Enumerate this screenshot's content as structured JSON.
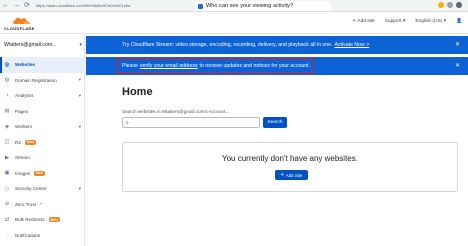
{
  "browser": {
    "back": "←",
    "forward": "→",
    "reload": "⟳",
    "url": "https://dash.cloudflare.com/9b548d6e5f7a02d401cba",
    "tab_title": "Who can see your viewing activity?"
  },
  "header": {
    "brand": "CLOUDFLARE",
    "add_site": "Add site",
    "support": "Support",
    "language": "English (US)",
    "accent": "#f6821f"
  },
  "sidebar": {
    "account": "Wtatters@gmail.com...",
    "items": [
      {
        "label": "Websites",
        "icon": "globe-icon",
        "glyph": "◎",
        "active": true
      },
      {
        "label": "Domain Registration",
        "icon": "globe-icon",
        "glyph": "◍",
        "caret": "▾"
      },
      {
        "label": "Analytics",
        "icon": "chart-icon",
        "glyph": "◔",
        "caret": "▾"
      },
      {
        "label": "Pages",
        "icon": "pages-icon",
        "glyph": "▤"
      },
      {
        "label": "Workers",
        "icon": "workers-icon",
        "glyph": "◈",
        "caret": "▾"
      },
      {
        "label": "R2",
        "icon": "storage-icon",
        "glyph": "◫",
        "badge": "New"
      },
      {
        "label": "Stream",
        "icon": "stream-icon",
        "glyph": "▶"
      },
      {
        "label": "Images",
        "icon": "image-icon",
        "glyph": "▣",
        "badge": "New"
      },
      {
        "label": "Security Center",
        "icon": "shield-icon",
        "glyph": "◇",
        "caret": "▾"
      },
      {
        "label": "Zero Trust",
        "icon": "lock-icon",
        "glyph": "⊖",
        "extra": "↗"
      },
      {
        "label": "Bulk Redirects",
        "icon": "redirect-icon",
        "glyph": "⇄",
        "badge": "Beta"
      },
      {
        "label": "Notifications",
        "icon": "bell-icon",
        "glyph": "◌"
      }
    ]
  },
  "banners": {
    "stream_text": "Try Cloudflare Stream: video storage, encoding, recording, delivery, and playback all in one.",
    "stream_link": "Activate Now >",
    "verify_pre": "Please",
    "verify_link": "verify your email address",
    "verify_post": "to receive updates and notices for your account.",
    "close": "✕"
  },
  "main": {
    "title": "Home",
    "search_label": "Search websites in Wtatters@gmail.com's Account...",
    "search_placeholder": "",
    "search_button": "Search",
    "empty_message": "You currently don't have any websites.",
    "add_site_button": "Add Site"
  }
}
